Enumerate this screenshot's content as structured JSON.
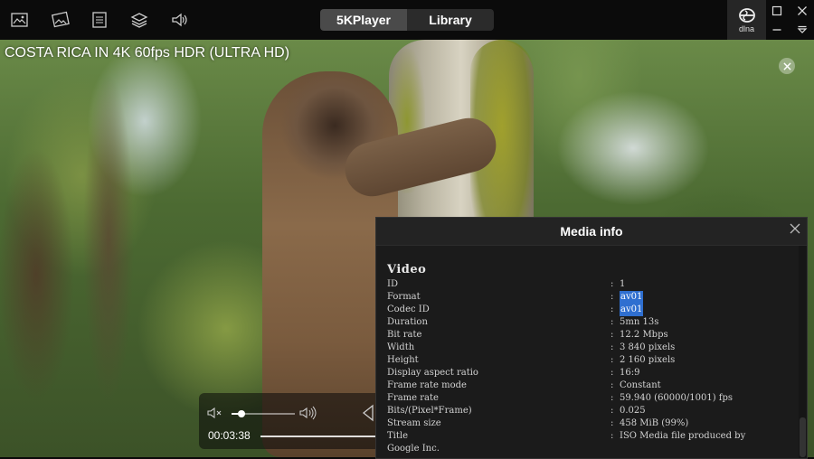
{
  "topbar": {
    "icons": [
      "photo-icon",
      "gallery-icon",
      "list-icon",
      "layers-icon",
      "speaker-icon"
    ],
    "tabs": [
      {
        "label": "5KPlayer",
        "active": true
      },
      {
        "label": "Library",
        "active": false
      }
    ],
    "dlna_label": "dlna"
  },
  "video": {
    "title": "COSTA RICA IN 4K 60fps HDR (ULTRA HD)"
  },
  "controls": {
    "time": "00:03:38",
    "volume": 0.15
  },
  "media_info": {
    "title": "Media info",
    "section": "Video",
    "rows": [
      {
        "key": "ID",
        "value": "1"
      },
      {
        "key": "Format",
        "value": "av01"
      },
      {
        "key": "Codec ID",
        "value": "av01"
      },
      {
        "key": "Duration",
        "value": "5mn 13s"
      },
      {
        "key": "Bit rate",
        "value": "12.2 Mbps"
      },
      {
        "key": "Width",
        "value": "3 840 pixels"
      },
      {
        "key": "Height",
        "value": "2 160 pixels"
      },
      {
        "key": "Display aspect ratio",
        "value": "16:9"
      },
      {
        "key": "Frame rate mode",
        "value": "Constant"
      },
      {
        "key": "Frame rate",
        "value": "59.940 (60000/1001) fps"
      },
      {
        "key": "Bits/(Pixel*Frame)",
        "value": "0.025"
      },
      {
        "key": "Stream size",
        "value": "458 MiB (99%)"
      },
      {
        "key": "Title",
        "value": "ISO Media file produced by"
      },
      {
        "key": "Google Inc.",
        "value": ""
      }
    ]
  }
}
